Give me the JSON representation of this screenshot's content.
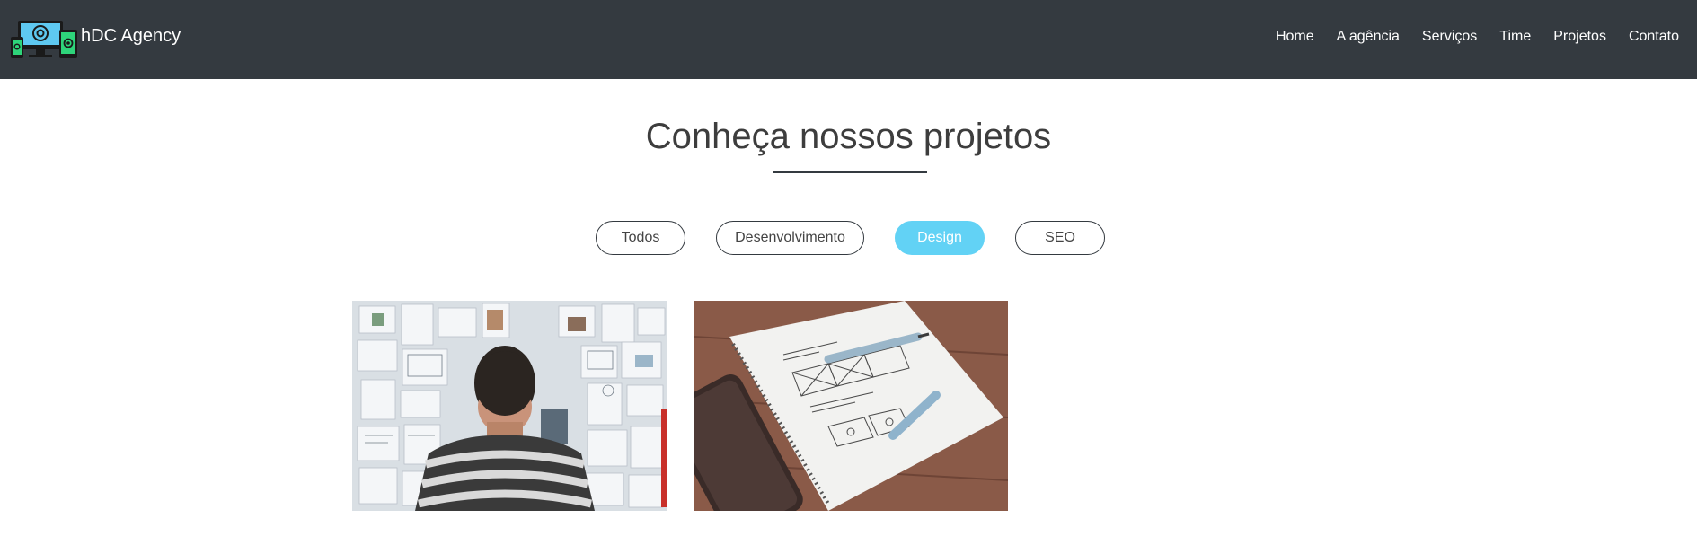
{
  "header": {
    "brand_name": "hDC Agency",
    "logo_icon": "devices-logo-icon",
    "nav": [
      {
        "label": "Home"
      },
      {
        "label": "A agência"
      },
      {
        "label": "Serviços"
      },
      {
        "label": "Time"
      },
      {
        "label": "Projetos"
      },
      {
        "label": "Contato"
      }
    ],
    "background_color": "#343a40"
  },
  "projects_section": {
    "title": "Conheça nossos projetos",
    "filters": [
      {
        "label": "Todos",
        "active": false
      },
      {
        "label": "Desenvolvimento",
        "active": false
      },
      {
        "label": "Design",
        "active": true
      },
      {
        "label": "SEO",
        "active": false
      }
    ],
    "active_filter_color": "#62d2f5",
    "projects": [
      {
        "image": "person-looking-at-moodboard-photo"
      },
      {
        "image": "wireframe-notebook-with-phone-photo"
      }
    ]
  }
}
